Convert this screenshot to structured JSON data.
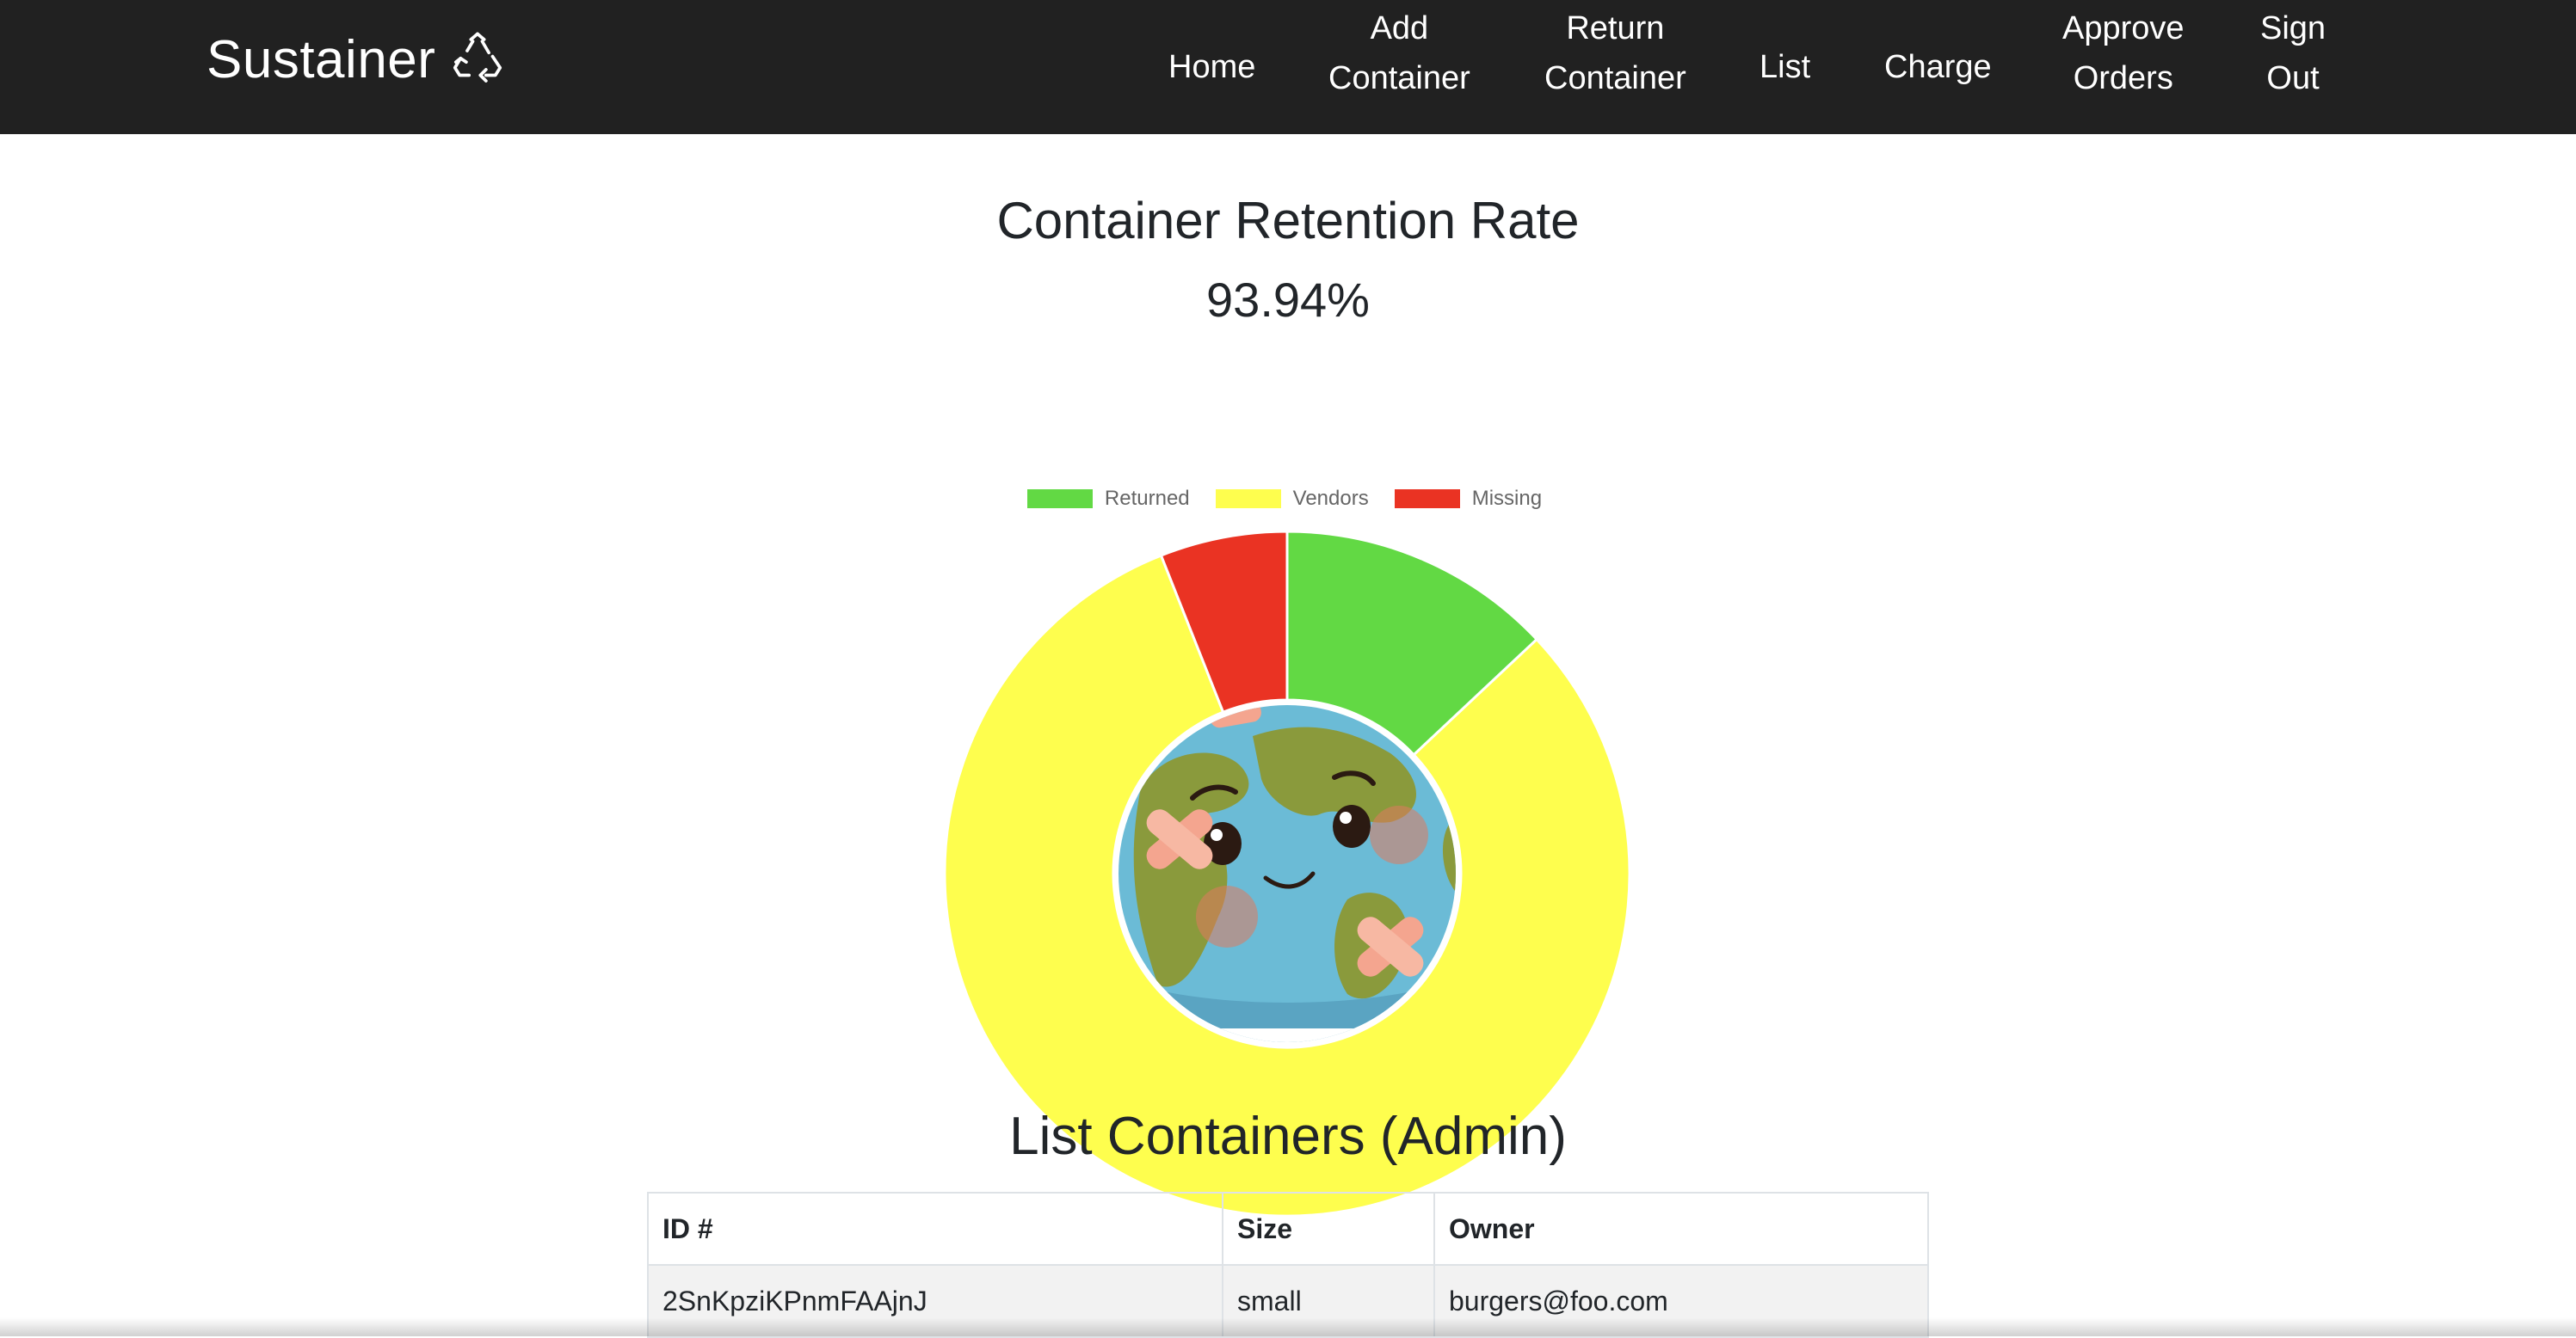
{
  "nav": {
    "brand": "Sustainer",
    "brand_icon": "recycle-icon",
    "items": [
      {
        "label": "Home"
      },
      {
        "label": "Add\nContainer"
      },
      {
        "label": "Return\nContainer"
      },
      {
        "label": "List"
      },
      {
        "label": "Charge"
      },
      {
        "label": "Approve\nOrders"
      },
      {
        "label": "Sign\nOut"
      }
    ]
  },
  "page": {
    "chart_title": "Container Retention Rate",
    "rate": "93.94%",
    "table_title": "List Containers (Admin)"
  },
  "colors": {
    "returned": "#62d944",
    "vendors": "#fefe4e",
    "missing": "#ea3323",
    "navbar": "#212121"
  },
  "chart_data": {
    "type": "pie",
    "variant": "doughnut",
    "title": "Container Retention Rate",
    "legend_position": "top",
    "center_image": "earth-illustration",
    "series": [
      {
        "name": "Returned",
        "value": 13
      },
      {
        "name": "Vendors",
        "value": 81
      },
      {
        "name": "Missing",
        "value": 6
      }
    ]
  },
  "table": {
    "headers": [
      "ID #",
      "Size",
      "Owner"
    ],
    "rows": [
      [
        "2SnKpziKPnmFAAjnJ",
        "small",
        "burgers@foo.com"
      ]
    ]
  }
}
